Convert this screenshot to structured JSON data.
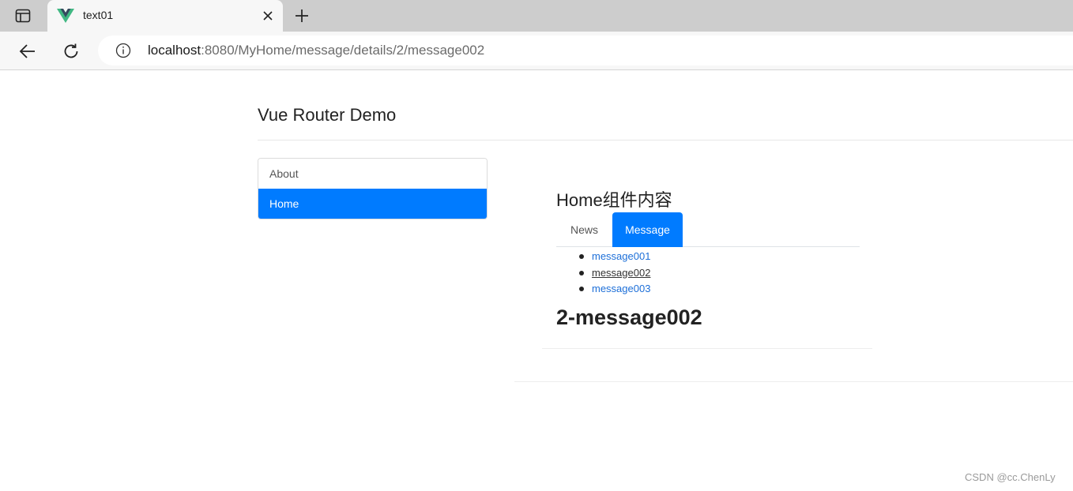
{
  "browser": {
    "tab": {
      "title": "text01",
      "favicon": "vue-logo-icon"
    },
    "url": {
      "host": "localhost",
      "rest": ":8080/MyHome/message/details/2/message002"
    }
  },
  "page": {
    "header": "Vue Router Demo",
    "sidebar": {
      "items": [
        {
          "label": "About",
          "active": false
        },
        {
          "label": "Home",
          "active": true
        }
      ]
    },
    "home": {
      "title": "Home组件内容",
      "tabs": [
        {
          "label": "News",
          "active": false
        },
        {
          "label": "Message",
          "active": true
        }
      ],
      "messages": [
        {
          "label": "message001",
          "current": false
        },
        {
          "label": "message002",
          "current": true
        },
        {
          "label": "message003",
          "current": false
        }
      ],
      "detail": "2-message002"
    }
  },
  "watermark": "CSDN @cc.ChenLy",
  "colors": {
    "primary": "#007bff",
    "link": "#1d6fd8"
  }
}
